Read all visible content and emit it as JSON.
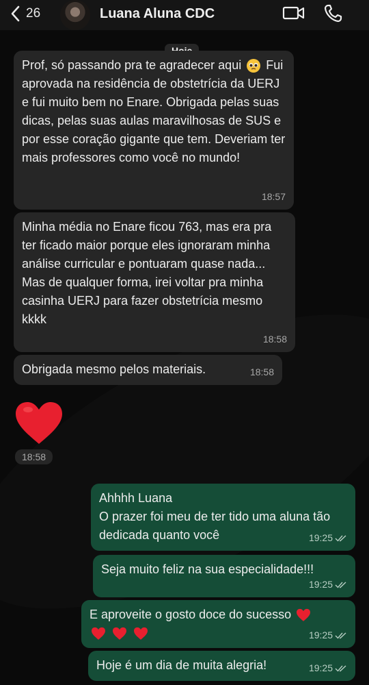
{
  "header": {
    "back_count": "26",
    "contact_name": "Luana Aluna CDC"
  },
  "chat": {
    "date_label": "Hoje",
    "messages": [
      {
        "type": "in",
        "text_before": "Prof, só passando pra te agradecer aqui",
        "text_after": "Fui aprovada na residência de obstetrícia da UERJ e fui muito bem no Enare. Obrigada pelas suas dicas, pelas suas aulas maravilhosas de SUS e por esse coração gigante que tem. Deveriam ter mais professores como você no mundo!",
        "time": "18:57"
      },
      {
        "type": "in",
        "text": "Minha média no Enare ficou 763, mas era pra ter ficado maior porque eles ignoraram minha análise curricular e pontuaram quase nada... Mas de qualquer forma, irei voltar pra minha casinha UERJ para fazer obstetrícia mesmo kkkk",
        "time": "18:58"
      },
      {
        "type": "in",
        "text": "Obrigada mesmo pelos materiais.",
        "time": "18:58"
      },
      {
        "type": "in",
        "emoji": "red-heart",
        "time": "18:58"
      },
      {
        "type": "out",
        "line1": "Ahhhh Luana",
        "line2": "O prazer foi meu de ter tido uma aluna tão dedicada quanto você",
        "time": "19:25",
        "status": "read"
      },
      {
        "type": "out",
        "text": "Seja muito feliz na sua especialidade!!!",
        "time": "19:25",
        "status": "read"
      },
      {
        "type": "out",
        "text": "E aproveite o gosto doce do sucesso",
        "emoji": "4x red-heart",
        "time": "19:25",
        "status": "read"
      },
      {
        "type": "out",
        "text": "Hoje é um dia de muita alegria!",
        "time": "19:25",
        "status": "read"
      }
    ]
  },
  "colors": {
    "incoming_bubble": "#262626",
    "outgoing_bubble": "#154d37",
    "background": "#0a0a0a"
  }
}
